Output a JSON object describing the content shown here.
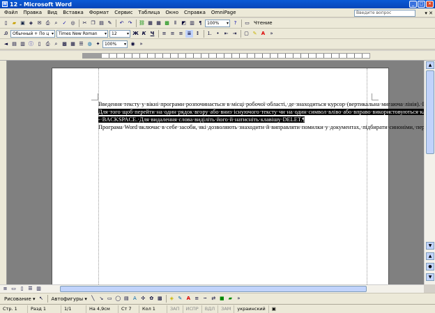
{
  "window": {
    "title": "12 - Microsoft Word",
    "app_icon": "W"
  },
  "menu": {
    "items": [
      "Файл",
      "Правка",
      "Вид",
      "Вставка",
      "Формат",
      "Сервис",
      "Таблица",
      "Окно",
      "Справка",
      "OmniPage"
    ],
    "ask_placeholder": "Введите вопрос"
  },
  "toolbar": {
    "zoom": "100%",
    "read_label": "Чтение"
  },
  "formatting": {
    "style": "Обычный + По ц",
    "font": "Times New Roman",
    "size": "12",
    "bold": "Ж",
    "italic": "К",
    "underline": "Ч"
  },
  "toolbar3": {
    "zoom": "100%"
  },
  "document": {
    "p1": "Введення·тексту·у·вікні·програми·розпочинається·в·місці·робочої·області,·де·знаходиться·курсор·(вертикальна·мигаюча·лінія).·При·досягненні·правого·поля·текст·автоматично·переходить·на·новий·рядок·в·межах·поточного·абзацу.·Щоб·створити·новий·абзац,·потрібно·в·кінці·рядка·нажати·клавішу·ENTER.··За·замовчуванням·програма·Word·використає·поля·шириною·3,175·см·(1,25·дюйми)·ліворуч·і·праворуч·і·2,54·см·(1·дюйм)·угорі·й·унизу,·однак·ці·значення·можна·змінити.¶",
    "p2_selected": "Для·того·щоб·перейти·на·один·рядок·вгору·або·вниз·існуючого·тексту·чи·на·один·символ·вліво·або·вправо·використовуються·клавіші·керування·курсором·(клавіші·зі·стрілками).·При·введенні·тексту·позиція·курсору·міняється,·указуючи·місце·введення·наступного·символу.·Якщо·допущено·помилку,·то·для·видалення·символу,·що·стоїть·справа·від·курсору·натисніть·клавішу·DELET,·а·зліва·--·BACKSPACE.·Для·видалення·слова·виділіть·його·й·натисніть·клавішу·DELET.¶",
    "p3": "Програма·Word·включає·в·себе·засоби,·які·дозволяють·знаходити·й·виправляти·помилки·у·документах,·підбирати·синоніми,·перевіряти·текст·на·різних·мовах.·Як·правило,·програма·Word·перевіряє·орфографічні·й·граматичні·помилки·одночасно.·За·замовчуванням·в·Word·встановлений·режим·фонової·перевірки·правопису·введеного·тексту.·Програма·Word·порівнює·кожне·слово·документа·зі·словами·у·своєму·стандартному·словнику.·Якщо·в·кінці·деякому·слові·виявляється·помилка,·це·слово·виділяється·хвилястою·лінією·у·вікні·документа.¶"
  },
  "drawing": {
    "draw_label": "Рисование ▾",
    "autoshapes_label": "Автофигуры ▾"
  },
  "status": {
    "page": "Стр. 1",
    "section": "Разд 1",
    "pages": "1/1",
    "pos": "На 4,9см",
    "line": "Ст 7",
    "col": "Кол 1",
    "rec": "ЗАП",
    "trk": "ИСПР",
    "ext": "ВДЛ",
    "ovr": "ЗАМ",
    "lang": "украинский"
  }
}
